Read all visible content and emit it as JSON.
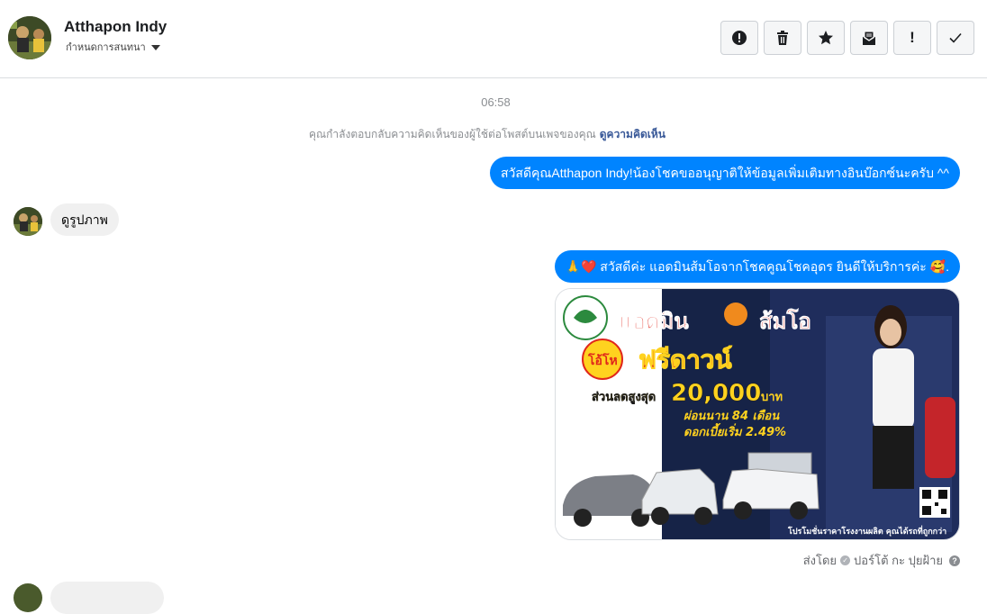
{
  "header": {
    "contact_name": "Atthapon Indy",
    "conversation_settings": "กำหนดการสนทนา",
    "toolbar_icons": [
      "report-icon",
      "trash-icon",
      "star-icon",
      "mark-unread-icon",
      "important-icon",
      "done-icon"
    ],
    "important_glyph": "!"
  },
  "thread": {
    "timestamp": "06:58",
    "notice_text": "คุณกำลังตอบกลับความคิดเห็นของผู้ใช้ต่อโพสต์บนเพจของคุณ",
    "notice_link": "ดูความคิดเห็น",
    "messages": [
      {
        "direction": "out",
        "text": "สวัสดีคุณAtthapon Indy!น้องโชคขออนุญาติให้ข้อมูลเพิ่มเติมทางอินบ๊อกซ์นะครับ ^^"
      },
      {
        "direction": "in",
        "text": "ดูรูปภาพ"
      },
      {
        "direction": "out",
        "text": "🙏❤️ สวัสดีค่ะ แอดมินส้มโอจากโชคคูณโชคอุดร ยินดีให้บริการค่ะ 🥰."
      }
    ],
    "ad_image": {
      "headline_1": "แอดมิน",
      "headline_2": "ส้มโอ",
      "promo_badge": "โอ้โห",
      "promo_title": "ฟรีดาวน์",
      "discount_label": "ส่วนลดสูงสุด",
      "discount_value": "20,000",
      "discount_unit": "บาท",
      "installment": "ผ่อนนาน 84 เดือน",
      "interest": "ดอกเบี้ยเริ่ม 2.49%",
      "footer": "โปรโมชั่นราคาโรงงานผลิต คุณได้รถที่ถูกกว่า"
    },
    "sent_by_label": "ส่งโดย",
    "sent_by_name": "ปอร์โต้ กะ ปุยฝ้าย"
  },
  "colors": {
    "outgoing_bubble": "#0084ff",
    "incoming_bubble": "#f0f0f0",
    "ad_red": "#e0261b",
    "ad_navy": "#1f2d5c"
  }
}
